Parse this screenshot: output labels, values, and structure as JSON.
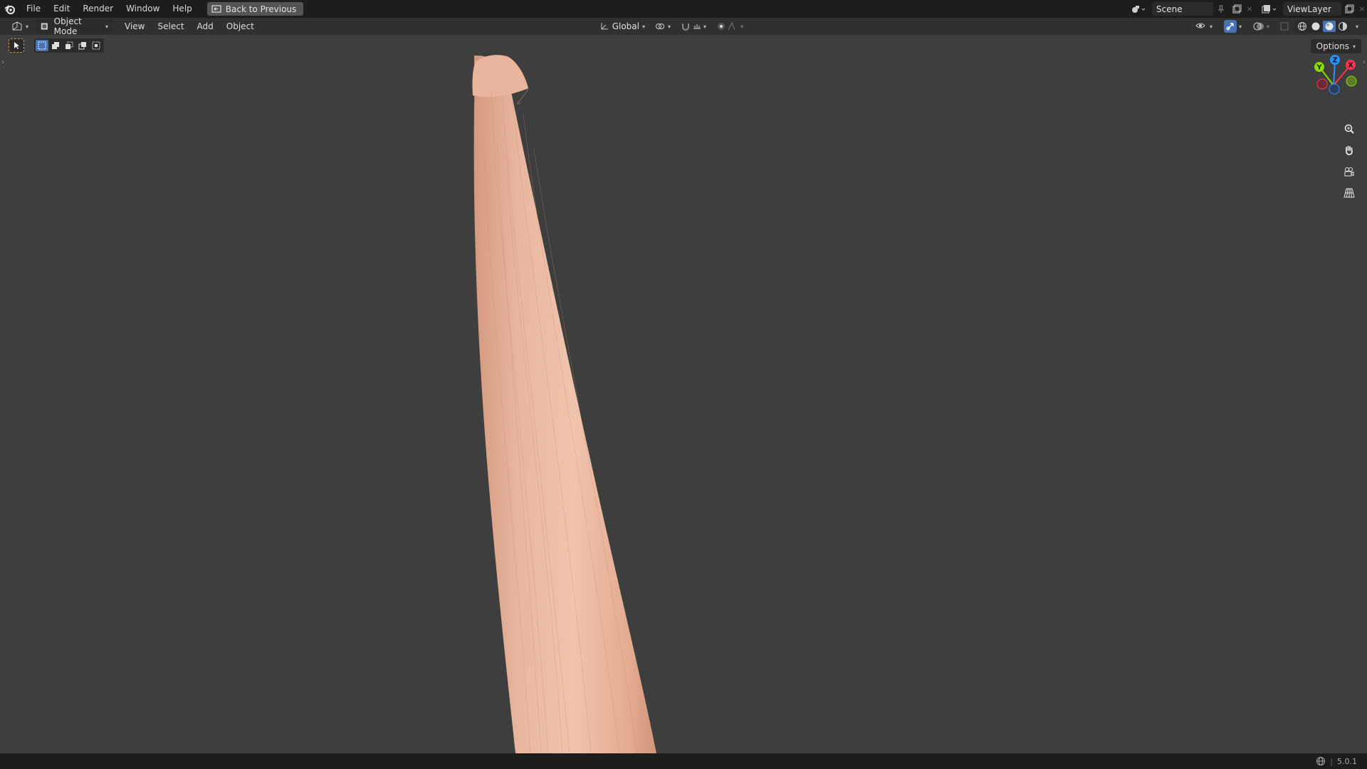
{
  "topbar": {
    "menu": [
      "File",
      "Edit",
      "Render",
      "Window",
      "Help"
    ],
    "back_button": "Back to Previous",
    "scene_name": "Scene",
    "view_layer_name": "ViewLayer"
  },
  "viewport_header": {
    "mode": "Object Mode",
    "menus": [
      "View",
      "Select",
      "Add",
      "Object"
    ],
    "transform_orientation": "Global"
  },
  "viewport": {
    "options_label": "Options",
    "gizmo_axes": {
      "z": "Z",
      "x": "X",
      "y": "Y"
    }
  },
  "statusbar": {
    "version": "5.0.1"
  },
  "colors": {
    "accent_blue": "#4772b3",
    "axis_x": "#ff3352",
    "axis_y": "#8bdc00",
    "axis_z": "#2890ff",
    "object_skin": "#e8b39a"
  }
}
